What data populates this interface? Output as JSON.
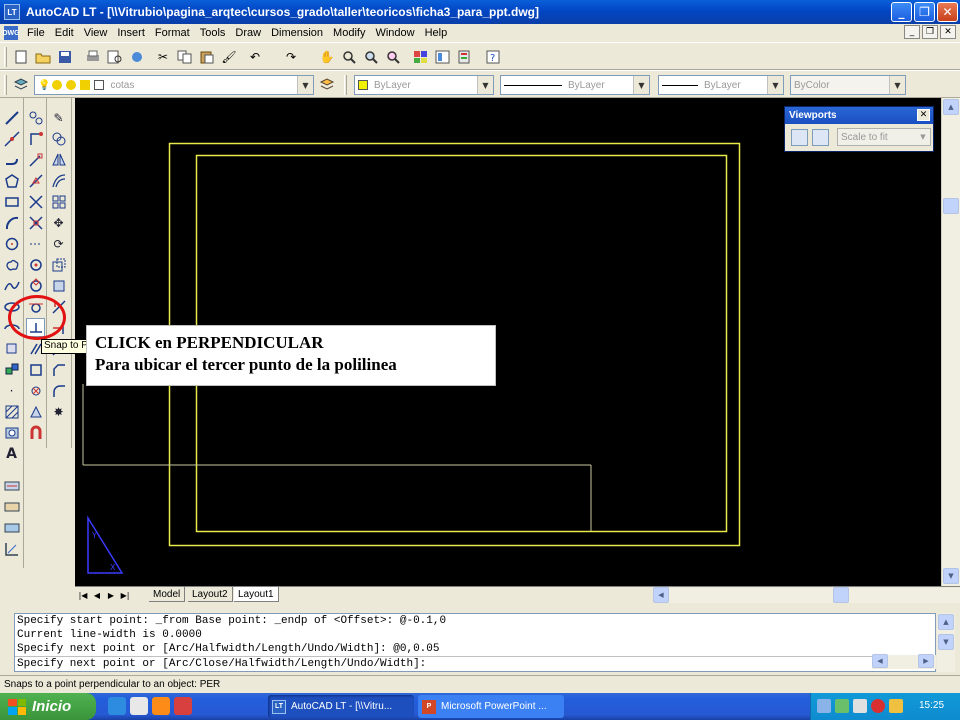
{
  "window": {
    "title": "AutoCAD LT - [\\\\Vitrubio\\pagina_arqtec\\cursos_grado\\taller\\teoricos\\ficha3_para_ppt.dwg]",
    "app_icon": "LT",
    "buttons": [
      "minimize-icon",
      "maximize-icon",
      "close-icon"
    ]
  },
  "menubar": {
    "items": [
      "File",
      "Edit",
      "View",
      "Insert",
      "Format",
      "Tools",
      "Draw",
      "Dimension",
      "Modify",
      "Window",
      "Help"
    ]
  },
  "layers_toolbar": {
    "layer_value": "cotas",
    "color_value": "ByLayer",
    "linetype_value": "ByLayer",
    "lineweight_value": "ByLayer",
    "plotstyle_value": "ByColor"
  },
  "viewports_toolbar": {
    "title": "Viewports",
    "scale_value": "Scale to fit"
  },
  "layout_tabs": {
    "tabs": [
      "Model",
      "Layout2",
      "Layout1"
    ],
    "active": "Layout1"
  },
  "command_history": [
    "Specify start point: _from Base point: _endp of <Offset>: @-0.1,0",
    "Current line-width is 0.0000",
    "Specify next point or [Arc/Halfwidth/Length/Undo/Width]: @0,0.05",
    "Specify next point or [Arc/Close/Halfwidth/Length/Undo/Width]:"
  ],
  "status_text": "Snaps to a point perpendicular to an object:  PER",
  "tooltip": "Snap to Perpendicular",
  "annotation": {
    "line1": "CLICK en PERPENDICULAR",
    "line2": "Para ubicar el tercer punto de la polilinea"
  },
  "taskbar": {
    "start_label": "Inicio",
    "tasks": [
      "AutoCAD LT - [\\\\Vitru...",
      "Microsoft PowerPoint ..."
    ],
    "clock": "15:25"
  },
  "colors": {
    "drawing_background": "#000000",
    "drawing_lines": "#e8e84a",
    "highlight_circle": "#e21212"
  }
}
